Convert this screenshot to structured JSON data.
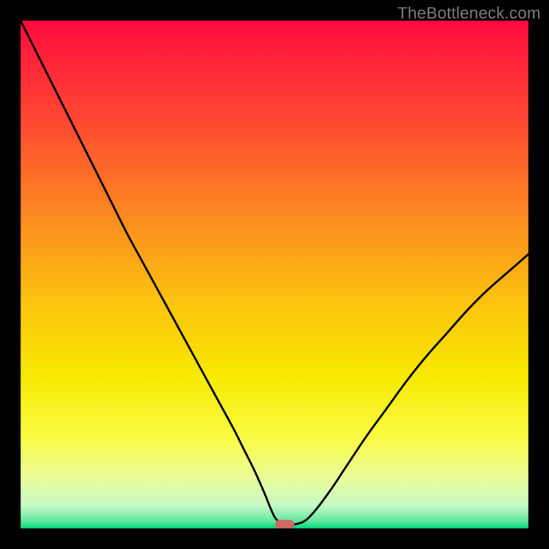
{
  "watermark": "TheBottleneck.com",
  "chart_data": {
    "type": "line",
    "title": "",
    "xlabel": "",
    "ylabel": "",
    "xlim": [
      0,
      100
    ],
    "ylim": [
      0,
      100
    ],
    "grid": false,
    "legend": false,
    "background": {
      "type": "vertical-gradient",
      "stops": [
        {
          "pos": 0.0,
          "color": "#ff0b3f"
        },
        {
          "pos": 0.2,
          "color": "#fe4931"
        },
        {
          "pos": 0.4,
          "color": "#fc8f1f"
        },
        {
          "pos": 0.55,
          "color": "#fcc20e"
        },
        {
          "pos": 0.7,
          "color": "#f7e900"
        },
        {
          "pos": 0.82,
          "color": "#fafc43"
        },
        {
          "pos": 0.9,
          "color": "#eafc9a"
        },
        {
          "pos": 0.955,
          "color": "#c7fac6"
        },
        {
          "pos": 0.985,
          "color": "#63e89f"
        },
        {
          "pos": 1.0,
          "color": "#00dc7c"
        }
      ]
    },
    "series": [
      {
        "name": "bottleneck-curve",
        "color": "#000000",
        "stroke_width": 3,
        "x": [
          0.0,
          3.0,
          6.0,
          9.0,
          12.0,
          15.0,
          18.0,
          21.0,
          24.0,
          27.0,
          30.0,
          33.0,
          36.0,
          39.0,
          42.0,
          44.0,
          46.0,
          48.0,
          49.0,
          50.0,
          51.0,
          52.0,
          54.0,
          56.0,
          58.0,
          61.0,
          64.0,
          68.0,
          72.0,
          76.0,
          80.0,
          84.0,
          88.0,
          92.0,
          96.0,
          100.0
        ],
        "y": [
          100.0,
          94.0,
          88.0,
          82.0,
          76.0,
          70.0,
          64.0,
          58.0,
          52.5,
          47.0,
          41.5,
          36.0,
          30.5,
          25.0,
          19.5,
          15.5,
          11.5,
          7.0,
          4.5,
          2.3,
          1.2,
          0.8,
          0.8,
          1.5,
          3.5,
          7.5,
          12.0,
          18.0,
          23.5,
          29.0,
          34.0,
          38.5,
          43.0,
          47.0,
          50.5,
          54.0
        ]
      }
    ],
    "marker": {
      "name": "optimal-point",
      "x": 52.0,
      "y": 0.8,
      "shape": "rounded-rect",
      "color": "#cf6a64"
    }
  }
}
